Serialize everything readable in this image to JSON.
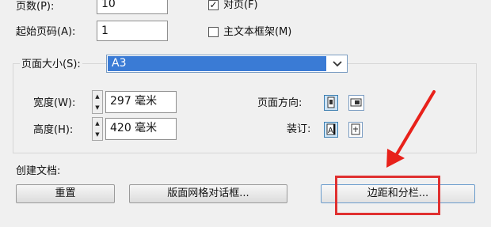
{
  "pages": {
    "label": "页数(P):",
    "value": "10"
  },
  "start_page": {
    "label": "起始页码(A):",
    "value": "1"
  },
  "facing_pages": {
    "label": "对页(F)",
    "checked": true
  },
  "primary_text_frame": {
    "label": "主文本框架(M)",
    "checked": false
  },
  "page_size": {
    "label": "页面大小(S):",
    "value": "A3"
  },
  "width": {
    "label": "宽度(W):",
    "value": "297 毫米"
  },
  "height": {
    "label": "高度(H):",
    "value": "420 毫米"
  },
  "orientation": {
    "label": "页面方向:",
    "selected": "portrait"
  },
  "binding": {
    "label": "装订:",
    "selected": "left-to-right"
  },
  "create_document": {
    "label": "创建文档:"
  },
  "buttons": {
    "reset": "重置",
    "layout_grid": "版面网格对话框...",
    "margins_columns": "边距和分栏..."
  },
  "colors": {
    "highlight_box": "#e03030",
    "arrow": "#e8211a",
    "select_blue": "#3a7bd5"
  }
}
